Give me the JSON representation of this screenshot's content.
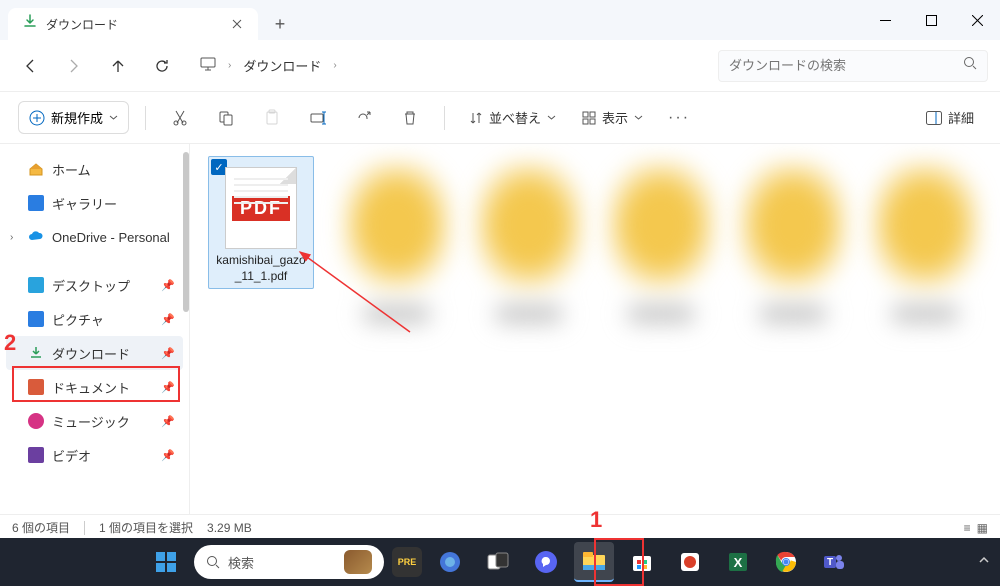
{
  "tab": {
    "title": "ダウンロード"
  },
  "breadcrumb": {
    "location": "ダウンロード"
  },
  "search": {
    "placeholder": "ダウンロードの検索"
  },
  "toolbar": {
    "new_label": "新規作成",
    "sort_label": "並べ替え",
    "view_label": "表示",
    "detail_label": "詳細"
  },
  "sidebar": {
    "home": "ホーム",
    "gallery": "ギャラリー",
    "onedrive": "OneDrive - Personal",
    "desktop": "デスクトップ",
    "pictures": "ピクチャ",
    "downloads": "ダウンロード",
    "documents": "ドキュメント",
    "music": "ミュージック",
    "videos": "ビデオ"
  },
  "file": {
    "name": "kamishibai_gazo_11_1.pdf",
    "badge": "PDF"
  },
  "status": {
    "items": "6 個の項目",
    "selected": "1 個の項目を選択",
    "size": "3.29 MB"
  },
  "annotations": {
    "num1": "1",
    "num2": "2"
  },
  "taskbar": {
    "search": "検索"
  }
}
